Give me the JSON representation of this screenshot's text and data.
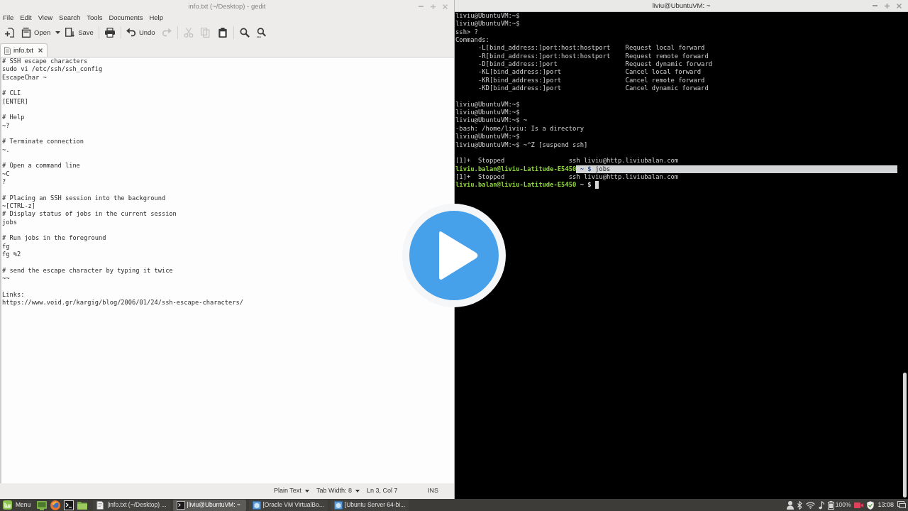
{
  "editor_window": {
    "title": "info.txt (~/Desktop) - gedit",
    "active": false,
    "menu": [
      "File",
      "Edit",
      "View",
      "Search",
      "Tools",
      "Documents",
      "Help"
    ],
    "toolbar_groups": [
      [
        {
          "kind": "new",
          "disabled": false
        },
        {
          "kind": "open",
          "label": "Open",
          "disabled": false,
          "menu": true
        },
        {
          "kind": "save",
          "label": "Save",
          "disabled": false
        }
      ],
      [
        {
          "kind": "print",
          "disabled": false
        }
      ],
      [
        {
          "kind": "undo",
          "label": "Undo",
          "disabled": false
        },
        {
          "kind": "redo",
          "disabled": true
        }
      ],
      [
        {
          "kind": "cut",
          "disabled": true
        },
        {
          "kind": "copy",
          "disabled": true
        },
        {
          "kind": "paste",
          "disabled": false
        }
      ],
      [
        {
          "kind": "find",
          "disabled": false
        },
        {
          "kind": "replace",
          "disabled": false
        }
      ]
    ],
    "tabs": [
      {
        "label": "info.txt",
        "selected": true
      }
    ],
    "text_blocks": [
      [
        "# SSH escape characters",
        "sudo vi /etc/ssh/ssh_config",
        "EscapeChar ~"
      ],
      [
        "# CLI",
        "[ENTER]"
      ],
      [
        "# Help",
        "~?"
      ],
      [
        "# Terminate connection",
        "~."
      ],
      [
        "# Open a command line",
        "~C",
        "?"
      ],
      [
        "# Placing an SSH session into the background",
        "~[CTRL-z]",
        "# Display status of jobs in the current session",
        "jobs"
      ],
      [
        "# Run jobs in the foreground",
        "fg",
        "fg %2"
      ],
      [
        "# send the escape character by typing it twice",
        "~~"
      ],
      [
        "Links:",
        "https://www.void.gr/kargig/blog/2006/01/24/ssh-escape-characters/"
      ]
    ],
    "status_bar": {
      "language": "Plain Text",
      "tab_width": "Tab Width: 8",
      "position": "Ln 3, Col 7",
      "mode": "INS"
    }
  },
  "terminal_window": {
    "title": "liviu@UbuntuVM: ~",
    "active": true,
    "blocks": [
      [
        {
          "kind": "output",
          "text": "liviu@UbuntuVM:~$"
        },
        {
          "kind": "output",
          "text": "liviu@UbuntuVM:~$"
        },
        {
          "kind": "output",
          "text": "ssh> ?"
        },
        {
          "kind": "output",
          "text": "Commands:"
        },
        {
          "kind": "output",
          "text": "      -L[bind_address:]port:host:hostport    Request local forward"
        },
        {
          "kind": "output",
          "text": "      -R[bind_address:]port:host:hostport    Request remote forward"
        },
        {
          "kind": "output",
          "text": "      -D[bind_address:]port                  Request dynamic forward"
        },
        {
          "kind": "output",
          "text": "      -KL[bind_address:]port                 Cancel local forward"
        },
        {
          "kind": "output",
          "text": "      -KR[bind_address:]port                 Cancel remote forward"
        },
        {
          "kind": "output",
          "text": "      -KD[bind_address:]port                 Cancel dynamic forward"
        }
      ],
      [
        {
          "kind": "output",
          "text": "liviu@UbuntuVM:~$"
        },
        {
          "kind": "output",
          "text": "liviu@UbuntuVM:~$"
        },
        {
          "kind": "output",
          "text": "liviu@UbuntuVM:~$ ~"
        },
        {
          "kind": "output",
          "text": "-bash: /home/liviu: Is a directory"
        },
        {
          "kind": "output",
          "text": "liviu@UbuntuVM:~$"
        },
        {
          "kind": "output",
          "text": "liviu@UbuntuVM:~$ ~^Z [suspend ssh]"
        }
      ],
      [
        {
          "kind": "output",
          "text": "[1]+  Stopped                 ssh liviu@http.liviubalan.com"
        },
        {
          "kind": "prompt",
          "user_host": "liviu.balan@liviu-Latitude-E5450",
          "symbol": "~ $",
          "command": "jobs",
          "selected": true,
          "cursor": false
        },
        {
          "kind": "output",
          "text": "[1]+  Stopped                 ssh liviu@http.liviubalan.com"
        },
        {
          "kind": "prompt",
          "user_host": "liviu.balan@liviu-Latitude-E5450",
          "symbol": "~ $",
          "selected": false,
          "cursor": true
        }
      ]
    ]
  },
  "taskbar": {
    "menu_label": "Menu",
    "launchers": [
      {
        "kind": "desktop"
      },
      {
        "kind": "browser"
      },
      {
        "kind": "terminal"
      },
      {
        "kind": "files"
      }
    ],
    "windows": [
      {
        "kind": "editor",
        "label": "|info.txt (~/Desktop) ...",
        "selected": false
      },
      {
        "kind": "terminal",
        "label": "|liviu@UbuntuVM: ~",
        "selected": true
      },
      {
        "kind": "virtualbox",
        "label": "[Oracle VM VirtualBo...",
        "selected": false
      },
      {
        "kind": "virtualbox",
        "label": "[Ubuntu Server 64-bi...",
        "selected": false
      }
    ],
    "tray": [
      {
        "kind": "user"
      },
      {
        "kind": "bluetooth"
      },
      {
        "kind": "wifi"
      },
      {
        "kind": "sound"
      },
      {
        "kind": "battery",
        "label": "100%"
      },
      {
        "kind": "recorder"
      },
      {
        "kind": "shield"
      },
      {
        "kind": "clock",
        "label": "13:08"
      },
      {
        "kind": "display"
      }
    ]
  }
}
